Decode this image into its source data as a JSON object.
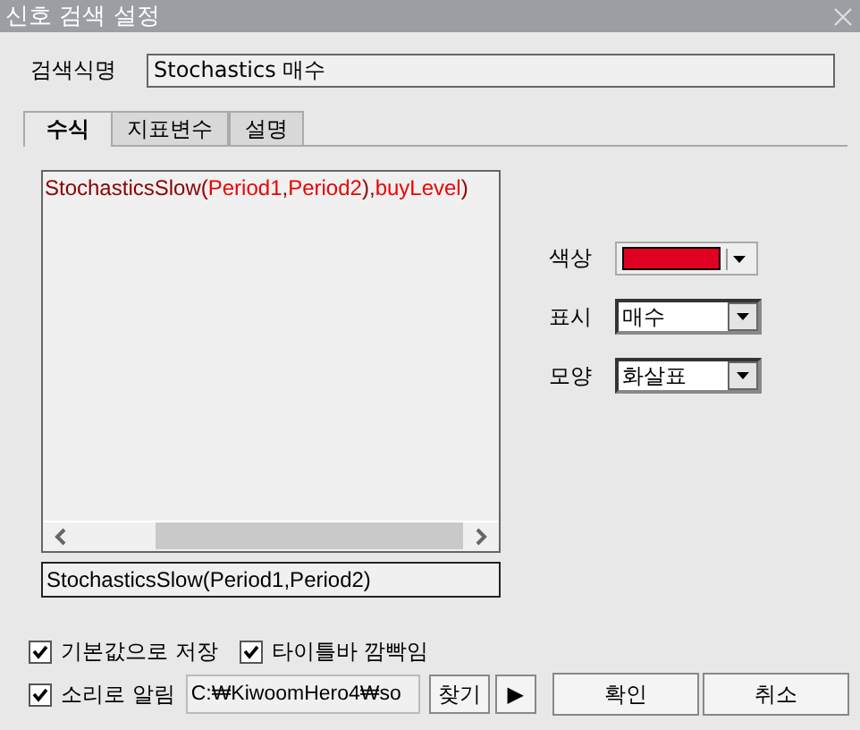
{
  "window": {
    "title": "신호 검색 설정"
  },
  "name_field": {
    "label": "검색식명",
    "value": "Stochastics 매수"
  },
  "tabs": [
    {
      "label": "수식",
      "selected": true
    },
    {
      "label": "지표변수",
      "selected": false
    },
    {
      "label": "설명",
      "selected": false
    }
  ],
  "formula": {
    "parts": [
      {
        "plain": "StochasticsSlow(",
        "variable": "Period1"
      },
      {
        "plain": ",",
        "variable": "Period2"
      },
      {
        "plain": "),",
        "variable": "buyLevel"
      },
      {
        "plain": ")"
      }
    ],
    "preview": "StochasticsSlow(Period1,Period2)"
  },
  "options": [
    {
      "label": "색상",
      "kind": "color",
      "color": "#e00020"
    },
    {
      "label": "표시",
      "kind": "select",
      "value": "매수"
    },
    {
      "label": "모양",
      "kind": "select",
      "value": "화살표"
    }
  ],
  "checkboxes": [
    {
      "label": "기본값으로 저장",
      "checked": true
    },
    {
      "label": "타이틀바 깜빡임",
      "checked": true
    },
    {
      "label": "소리로 알림",
      "checked": true
    }
  ],
  "sound_path": "C:₩KiwoomHero4₩so",
  "browse_button": "찾기",
  "play_button": "▶",
  "buttons": [
    "확인",
    "취소"
  ]
}
